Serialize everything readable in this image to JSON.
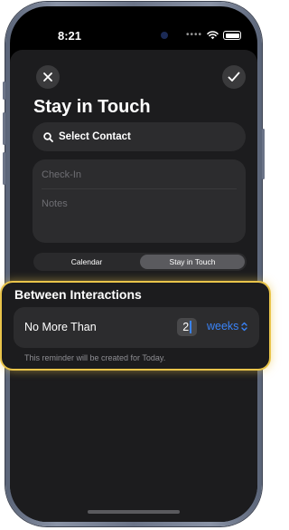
{
  "status_bar": {
    "time": "8:21",
    "signal_dots": "••••",
    "icons": [
      "island-camera-icon",
      "wifi-icon",
      "battery-icon"
    ]
  },
  "toolbar": {
    "close_icon": "close-icon",
    "confirm_icon": "checkmark-icon"
  },
  "page": {
    "title": "Stay in Touch"
  },
  "contact": {
    "label": "Select Contact",
    "icon": "search-icon"
  },
  "form": {
    "checkin_placeholder": "Check-In",
    "notes_placeholder": "Notes"
  },
  "segment": {
    "options": [
      "Calendar",
      "Stay in Touch"
    ],
    "selected": "Stay in Touch"
  },
  "interval": {
    "section_title": "Between Interactions",
    "row_label": "No More Than",
    "value": "2",
    "unit": "weeks",
    "unit_icon": "chevron-up-down-icon",
    "footnote": "This reminder will be created for Today."
  },
  "colors": {
    "accent": "#3a83f7",
    "highlight": "#e9c44a",
    "sheet": "#1c1c1e",
    "card": "#2c2c2e"
  }
}
